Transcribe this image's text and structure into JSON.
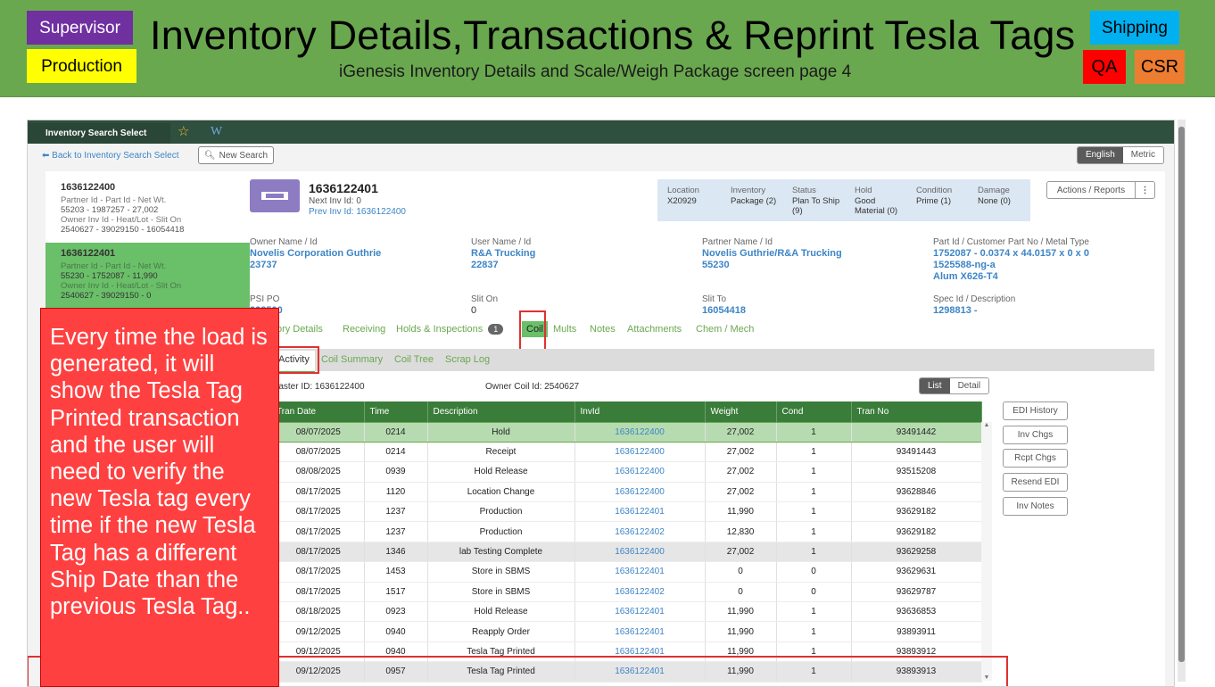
{
  "banner": {
    "title": "Inventory Details,Transactions & Reprint Tesla Tags",
    "subtitle": "iGenesis Inventory Details and Scale/Weigh Package screen page 4",
    "tags": {
      "supervisor": "Supervisor",
      "production": "Production",
      "shipping": "Shipping",
      "qa": "QA",
      "csr": "CSR"
    },
    "colors": {
      "banner": "#6aa84f",
      "supervisor": "#7030a0",
      "production": "#ffff00",
      "shipping": "#00b0f0",
      "qa": "#ff0000",
      "csr": "#ed7d31"
    }
  },
  "app": {
    "tab_title": "Inventory Search Select",
    "star_icon": "star-icon",
    "w_icon": "W",
    "back_link": "Back to Inventory Search Select",
    "new_search": "New Search",
    "units": [
      "English",
      "Metric"
    ],
    "units_selected": "English"
  },
  "inventory_list": [
    {
      "id": "1636122400",
      "line1_label": "Partner Id - Part Id - Net Wt.",
      "line1_value": "55203 - 1987257 - 27,002",
      "line2_label": "Owner Inv Id - Heat/Lot - Slit On",
      "line2_value": "2540627 - 39029150 - 16054418",
      "selected": false
    },
    {
      "id": "1636122401",
      "line1_label": "Partner Id - Part Id - Net Wt.",
      "line1_value": "55230 - 1752087 - 11,990",
      "line2_label": "Owner Inv Id - Heat/Lot - Slit On",
      "line2_value": "2540627 - 39029150 - 0",
      "selected": true
    }
  ],
  "detail": {
    "inv_id": "1636122401",
    "next_inv": "Next Inv Id:  0",
    "prev_inv": "Prev Inv Id:  1636122400",
    "status_box": [
      {
        "label": "Location",
        "value": "X20929"
      },
      {
        "label": "Inventory",
        "value": "Package (2)"
      },
      {
        "label": "Status",
        "value": "Plan To Ship (9)"
      },
      {
        "label": "Hold",
        "value": "Good Material (0)"
      },
      {
        "label": "Condition",
        "value": "Prime (1)"
      },
      {
        "label": "Damage",
        "value": "None (0)"
      }
    ],
    "actions_label": "Actions / Reports",
    "fields": {
      "owner_label": "Owner Name / Id",
      "owner_name": "Novelis Corporation Guthrie",
      "owner_id": "23737",
      "user_label": "User Name / Id",
      "user_name": "R&A Trucking",
      "user_id": "22837",
      "partner_label": "Partner Name / Id",
      "partner_name": "Novelis Guthrie/R&A Trucking",
      "partner_id": "55230",
      "part_label": "Part Id / Customer Part No / Metal Type",
      "part_line1": "1752087 - 0.0374 x 44.0157 x 0 x 0",
      "part_line2": "1525588-ng-a",
      "part_line3": "Alum X626-T4",
      "psi_label": "PSI PO",
      "psi_value": "228500",
      "slit_on_label": "Slit On",
      "slit_on_value": "0",
      "slit_to_label": "Slit To",
      "slit_to_value": "16054418",
      "spec_label": "Spec Id / Description",
      "spec_value": "1298813 -"
    },
    "tabs": {
      "inventory_details": "Inventory Details",
      "receiving": "Receiving",
      "holds": "Holds & Inspections",
      "holds_badge": "1",
      "coil": "Coil",
      "mults": "Mults",
      "notes": "Notes",
      "attachments": "Attachments",
      "chem": "Chem / Mech"
    },
    "subtabs": {
      "activity": "Activity",
      "coil_summary": "Coil Summary",
      "coil_tree": "Coil Tree",
      "scrap_log": "Scrap Log"
    },
    "master_id": "Master ID: 1636122400",
    "owner_coil": "Owner Coil Id: 2540627",
    "views": [
      "List",
      "Detail"
    ],
    "side_buttons": [
      "EDI History",
      "Inv Chgs",
      "Rcpt Chgs",
      "Resend EDI",
      "Inv Notes"
    ]
  },
  "table": {
    "headers": [
      "Tran Date",
      "Time",
      "Description",
      "InvId",
      "Weight",
      "Cond",
      "Tran No"
    ],
    "rows": [
      [
        "08/07/2025",
        "0214",
        "Hold",
        "1636122400",
        "27,002",
        "1",
        "93491442"
      ],
      [
        "08/07/2025",
        "0214",
        "Receipt",
        "1636122400",
        "27,002",
        "1",
        "93491443"
      ],
      [
        "08/08/2025",
        "0939",
        "Hold Release",
        "1636122400",
        "27,002",
        "1",
        "93515208"
      ],
      [
        "08/17/2025",
        "1120",
        "Location Change",
        "1636122400",
        "27,002",
        "1",
        "93628846"
      ],
      [
        "08/17/2025",
        "1237",
        "Production",
        "1636122401",
        "11,990",
        "1",
        "93629182"
      ],
      [
        "08/17/2025",
        "1237",
        "Production",
        "1636122402",
        "12,830",
        "1",
        "93629182"
      ],
      [
        "08/17/2025",
        "1346",
        "lab Testing Complete",
        "1636122400",
        "27,002",
        "1",
        "93629258"
      ],
      [
        "08/17/2025",
        "1453",
        "Store in SBMS",
        "1636122401",
        "0",
        "0",
        "93629631"
      ],
      [
        "08/17/2025",
        "1517",
        "Store in SBMS",
        "1636122402",
        "0",
        "0",
        "93629787"
      ],
      [
        "08/18/2025",
        "0923",
        "Hold Release",
        "1636122401",
        "11,990",
        "1",
        "93636853"
      ],
      [
        "09/12/2025",
        "0940",
        "Reapply Order",
        "1636122401",
        "11,990",
        "1",
        "93893911"
      ],
      [
        "09/12/2025",
        "0940",
        "Tesla Tag Printed",
        "1636122401",
        "11,990",
        "1",
        "93893912"
      ],
      [
        "09/12/2025",
        "0957",
        "Tesla Tag Printed",
        "1636122401",
        "11,990",
        "1",
        "93893913"
      ]
    ]
  },
  "callout": "Every time the load is generated, it will show the Tesla Tag Printed transaction and the user will need to verify the new Tesla tag every time if the new Tesla Tag has a different Ship Date than the previous Tesla Tag.."
}
